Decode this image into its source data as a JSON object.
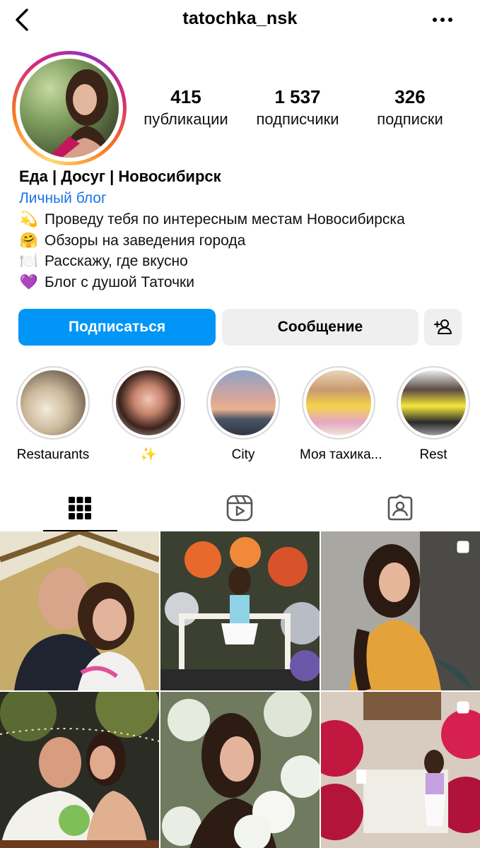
{
  "header": {
    "username": "tatochka_nsk",
    "back_icon": "chevron-left-icon",
    "more_icon": "more-horizontal-icon"
  },
  "stats": [
    {
      "value": "415",
      "label": "публикации"
    },
    {
      "value": "1 537",
      "label": "подписчики"
    },
    {
      "value": "326",
      "label": "подписки"
    }
  ],
  "bio": {
    "name": "Еда | Досуг | Новосибирск",
    "category": "Личный блог",
    "lines": [
      {
        "emoji": "💫",
        "text": "Проведу тебя по интересным местам Новосибирска"
      },
      {
        "emoji": "🤗",
        "text": "Обзоры на заведения города"
      },
      {
        "emoji": "🍽️",
        "text": "Расскажу, где вкусно"
      },
      {
        "emoji": "💜",
        "text": "Блог с душой Таточки"
      }
    ]
  },
  "actions": {
    "follow_label": "Подписаться",
    "message_label": "Сообщение",
    "add_person_icon": "add-person-icon"
  },
  "highlights": [
    {
      "label": "Restaurants"
    },
    {
      "label": "✨"
    },
    {
      "label": "City"
    },
    {
      "label": "Моя тахика..."
    },
    {
      "label": "Rest"
    }
  ],
  "tabs": [
    {
      "icon": "grid-icon",
      "active": true
    },
    {
      "icon": "reels-icon",
      "active": false
    },
    {
      "icon": "tagged-icon",
      "active": false
    }
  ],
  "colors": {
    "accent": "#0095f6",
    "link": "#1a73e8",
    "button_secondary": "#efefef"
  }
}
